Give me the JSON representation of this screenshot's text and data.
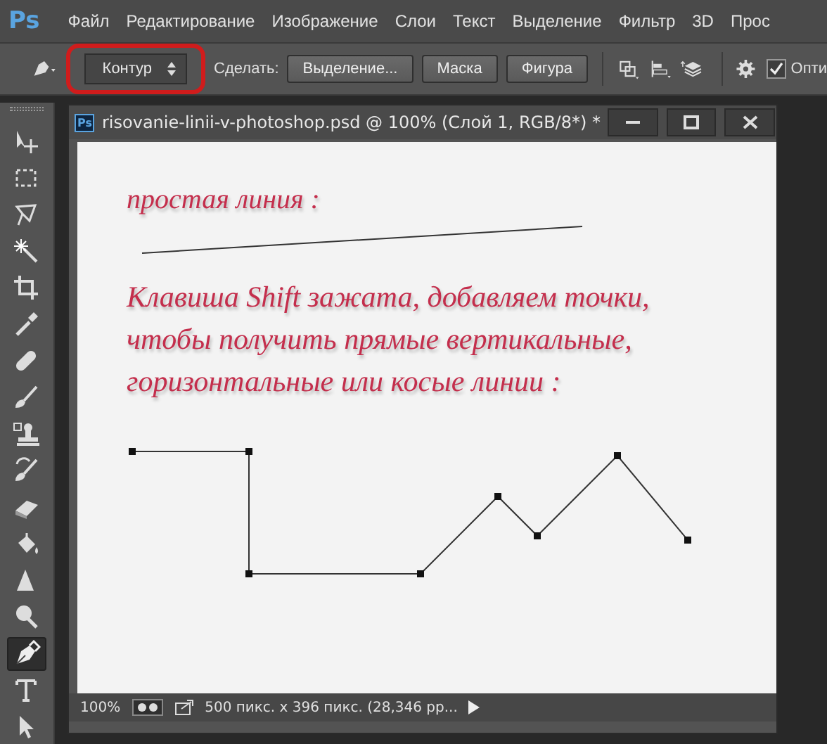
{
  "app_logo": "Ps",
  "menu": [
    "Файл",
    "Редактирование",
    "Изображение",
    "Слои",
    "Текст",
    "Выделение",
    "Фильтр",
    "3D",
    "Прос"
  ],
  "options_bar": {
    "mode_dropdown": "Контур",
    "highlighted": true,
    "make_label": "Сделать:",
    "buttons": [
      "Выделение...",
      "Маска",
      "Фигура"
    ],
    "option_checkbox": {
      "label": "Опти",
      "checked": true
    }
  },
  "tools": [
    {
      "kind": "move",
      "selected": false
    },
    {
      "kind": "marquee",
      "selected": false
    },
    {
      "kind": "lasso",
      "selected": false
    },
    {
      "kind": "wand",
      "selected": false
    },
    {
      "kind": "crop",
      "selected": false
    },
    {
      "kind": "eyedropper",
      "selected": false
    },
    {
      "kind": "healing",
      "selected": false
    },
    {
      "kind": "brush",
      "selected": false
    },
    {
      "kind": "stamp",
      "selected": false
    },
    {
      "kind": "history",
      "selected": false
    },
    {
      "kind": "eraser",
      "selected": false
    },
    {
      "kind": "bucket",
      "selected": false
    },
    {
      "kind": "sharpen",
      "selected": false
    },
    {
      "kind": "dodge",
      "selected": false
    },
    {
      "kind": "pen",
      "selected": true
    },
    {
      "kind": "type",
      "selected": false
    },
    {
      "kind": "select",
      "selected": false
    }
  ],
  "document": {
    "icon_label": "Ps",
    "title": "risovanie-linii-v-photoshop.psd @ 100% (Слой 1, RGB/8*) *",
    "canvas": {
      "caption": "простая линия :",
      "paragraph": "Клавиша Shift зажата, добавляем точки, чтобы получить прямые вертикальные, горизонтальные или косые линии :"
    },
    "status_bar": {
      "zoom": "100%",
      "info": "500 пикс. x 396 пикс. (28,346 pp..."
    }
  }
}
